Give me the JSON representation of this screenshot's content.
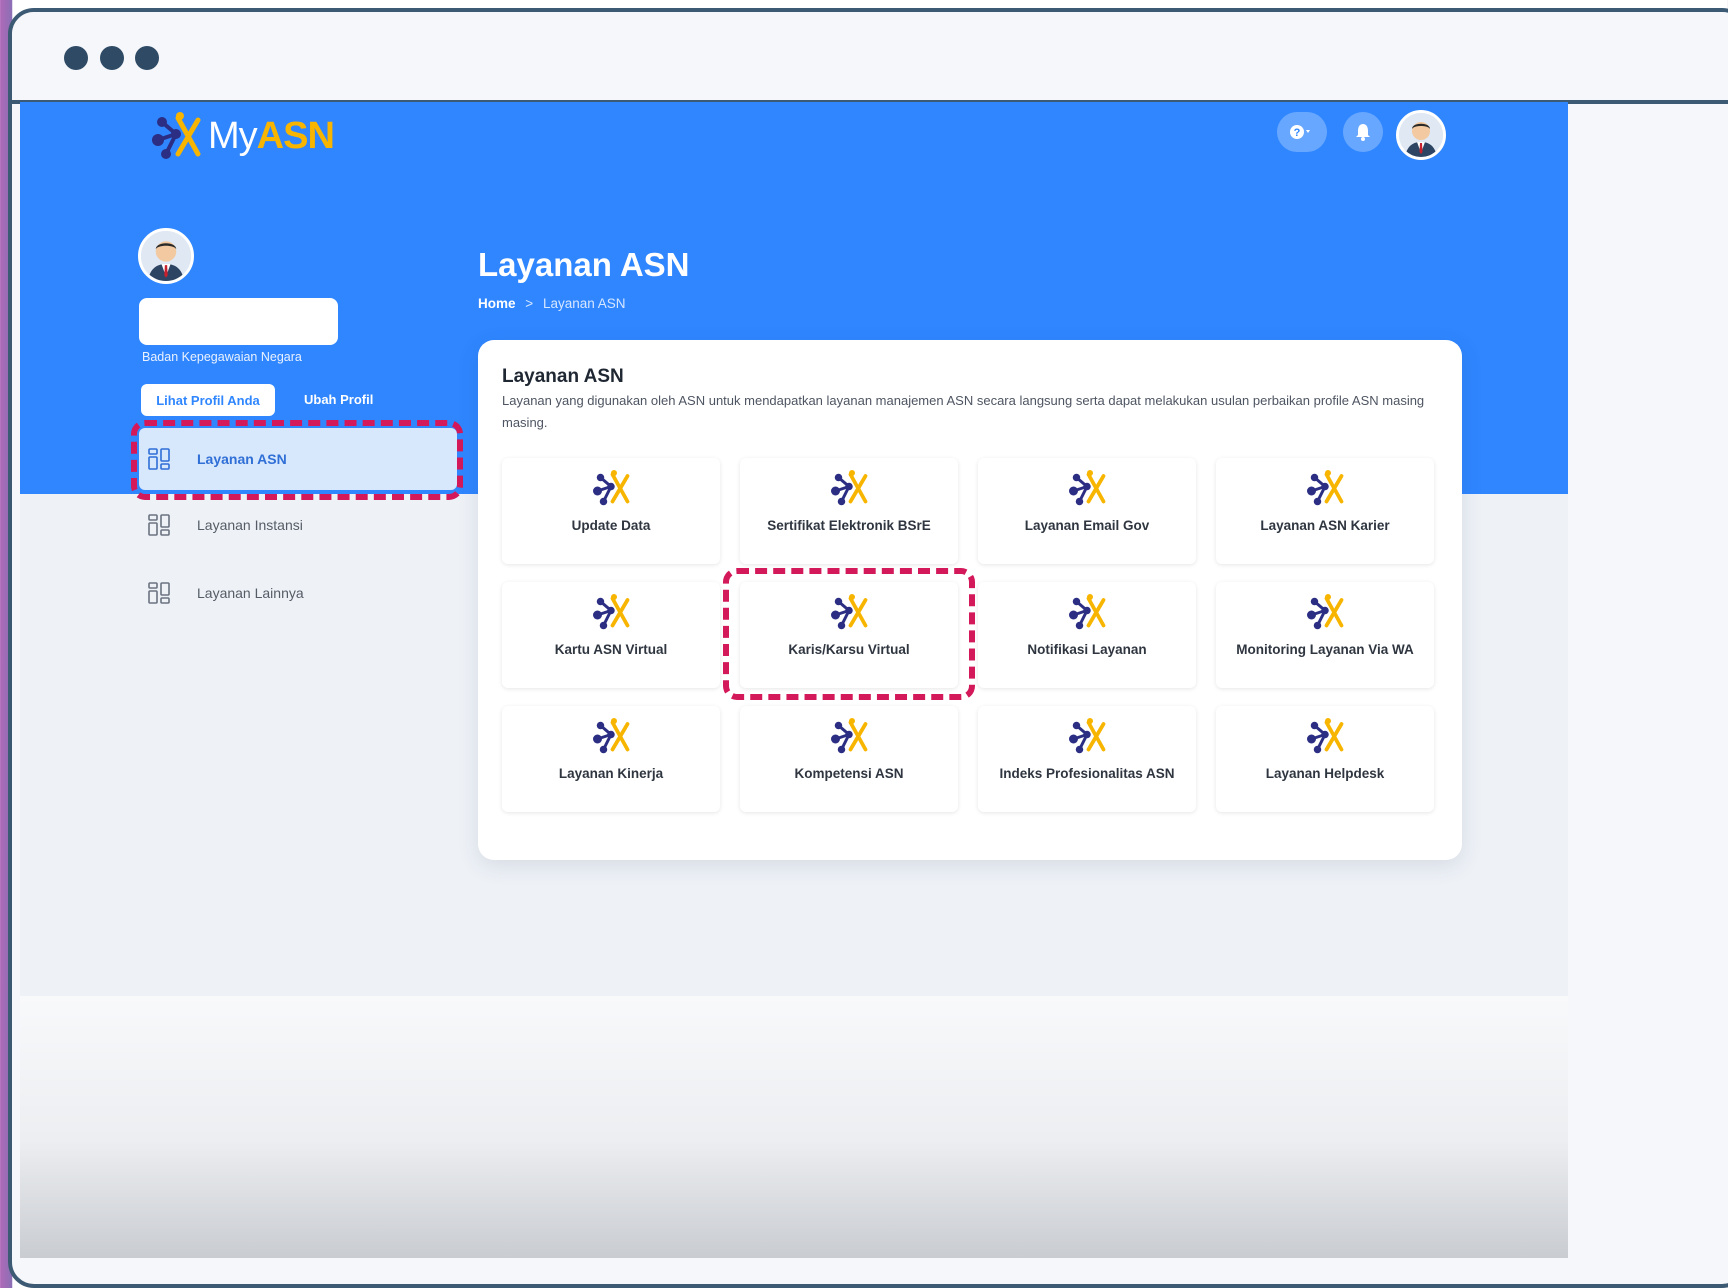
{
  "app": {
    "logo": {
      "my": "My",
      "asn": "ASN"
    }
  },
  "profile": {
    "organization": "Badan Kepegawaian Negara",
    "view_profile_label": "Lihat Profil Anda",
    "edit_profile_label": "Ubah Profil"
  },
  "sidebar": {
    "items": [
      {
        "label": "Layanan ASN",
        "active": true
      },
      {
        "label": "Layanan Instansi",
        "active": false
      },
      {
        "label": "Layanan Lainnya",
        "active": false
      }
    ]
  },
  "page": {
    "title": "Layanan ASN",
    "breadcrumb": {
      "home": "Home",
      "separator": ">",
      "current": "Layanan ASN"
    }
  },
  "card": {
    "title": "Layanan ASN",
    "description": "Layanan yang digunakan oleh ASN untuk mendapatkan layanan manajemen ASN secara langsung serta dapat melakukan usulan perbaikan profile ASN masing masing.",
    "tiles": [
      "Update Data",
      "Sertifikat Elektronik BSrE",
      "Layanan Email Gov",
      "Layanan ASN Karier",
      "Kartu ASN Virtual",
      "Karis/Karsu Virtual",
      "Notifikasi Layanan",
      "Monitoring Layanan Via WA",
      "Layanan Kinerja",
      "Kompetensi ASN",
      "Indeks Profesionalitas ASN",
      "Layanan Helpdesk"
    ]
  },
  "header": {
    "icons": [
      "help-icon",
      "bell-icon",
      "user-avatar"
    ]
  },
  "colors": {
    "primary": "#2f86ff",
    "highlight": "#d4195a",
    "logo_accent": "#f7b500",
    "logo_dark": "#2b2e83"
  }
}
